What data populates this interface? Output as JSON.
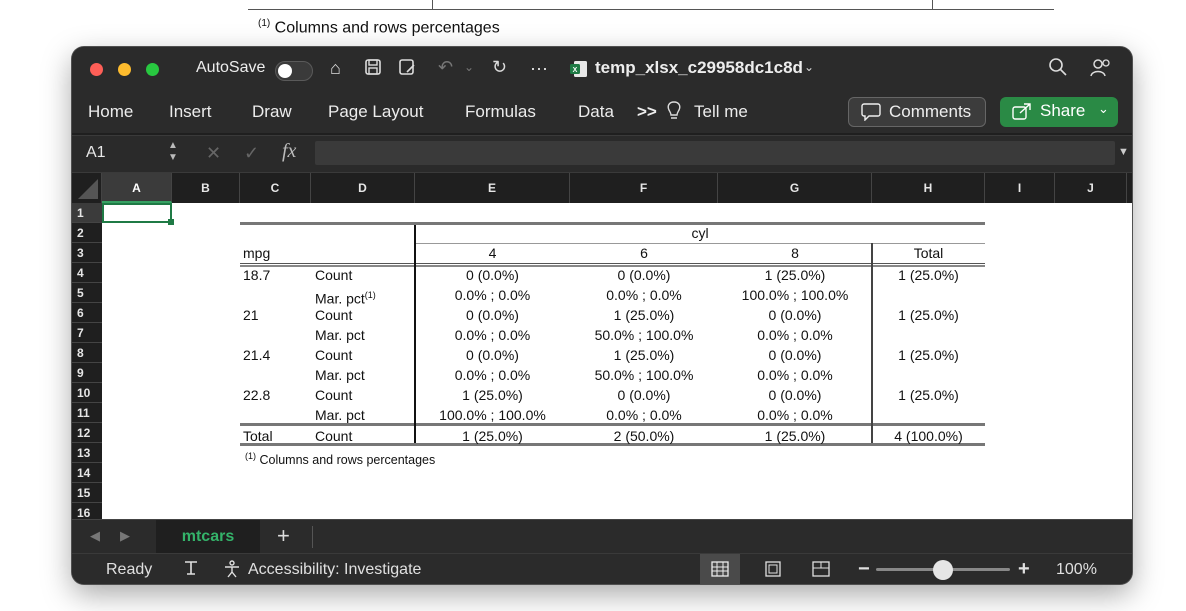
{
  "background_doc": {
    "note_sup": "(1)",
    "note": " Columns and rows percentages"
  },
  "titlebar": {
    "autosave_label": "AutoSave",
    "filename": "temp_xlsx_c29958dc1c8d",
    "more": "···"
  },
  "ribbon": {
    "tabs": [
      "Home",
      "Insert",
      "Draw",
      "Page Layout",
      "Formulas",
      "Data"
    ],
    "more": ">>",
    "tell_me": "Tell me",
    "comments": "Comments",
    "share": "Share"
  },
  "formula_bar": {
    "name_box": "A1",
    "fx": "fx",
    "value": ""
  },
  "columns": [
    "A",
    "B",
    "C",
    "D",
    "E",
    "F",
    "G",
    "H",
    "I",
    "J"
  ],
  "rows": [
    "1",
    "2",
    "3",
    "4",
    "5",
    "6",
    "7",
    "8",
    "9",
    "10",
    "11",
    "12",
    "13",
    "14",
    "15",
    "16"
  ],
  "table": {
    "cyl_label": "cyl",
    "row_var": "mpg",
    "col_headers": [
      "4",
      "6",
      "8",
      "Total"
    ],
    "rows": [
      {
        "mpg": "18.7",
        "stat": "Count",
        "v": [
          "0 (0.0%)",
          "0 (0.0%)",
          "1 (25.0%)",
          "1 (25.0%)"
        ]
      },
      {
        "mpg": "",
        "stat": "Mar. pct",
        "stat_sup": "(1)",
        "v": [
          "0.0% ; 0.0%",
          "0.0% ; 0.0%",
          "100.0% ; 100.0%",
          ""
        ]
      },
      {
        "mpg": "21",
        "stat": "Count",
        "v": [
          "0 (0.0%)",
          "1 (25.0%)",
          "0 (0.0%)",
          "1 (25.0%)"
        ]
      },
      {
        "mpg": "",
        "stat": "Mar. pct",
        "v": [
          "0.0% ; 0.0%",
          "50.0% ; 100.0%",
          "0.0% ; 0.0%",
          ""
        ]
      },
      {
        "mpg": "21.4",
        "stat": "Count",
        "v": [
          "0 (0.0%)",
          "1 (25.0%)",
          "0 (0.0%)",
          "1 (25.0%)"
        ]
      },
      {
        "mpg": "",
        "stat": "Mar. pct",
        "v": [
          "0.0% ; 0.0%",
          "50.0% ; 100.0%",
          "0.0% ; 0.0%",
          ""
        ]
      },
      {
        "mpg": "22.8",
        "stat": "Count",
        "v": [
          "1 (25.0%)",
          "0 (0.0%)",
          "0 (0.0%)",
          "1 (25.0%)"
        ]
      },
      {
        "mpg": "",
        "stat": "Mar. pct",
        "v": [
          "100.0% ; 100.0%",
          "0.0% ; 0.0%",
          "0.0% ; 0.0%",
          ""
        ]
      },
      {
        "mpg": "Total",
        "stat": "Count",
        "v": [
          "1 (25.0%)",
          "2 (50.0%)",
          "1 (25.0%)",
          "4 (100.0%)"
        ]
      }
    ],
    "footnote_sup": "(1)",
    "footnote": " Columns and rows percentages"
  },
  "sheet_tabs": {
    "active": "mtcars",
    "add": "+"
  },
  "statusbar": {
    "ready": "Ready",
    "accessibility": "Accessibility: Investigate",
    "zoom": "100%",
    "zoom_level": 0.5
  },
  "colors": {
    "accent_green": "#2a8a45",
    "sheet_tab_green": "#34b36a"
  }
}
